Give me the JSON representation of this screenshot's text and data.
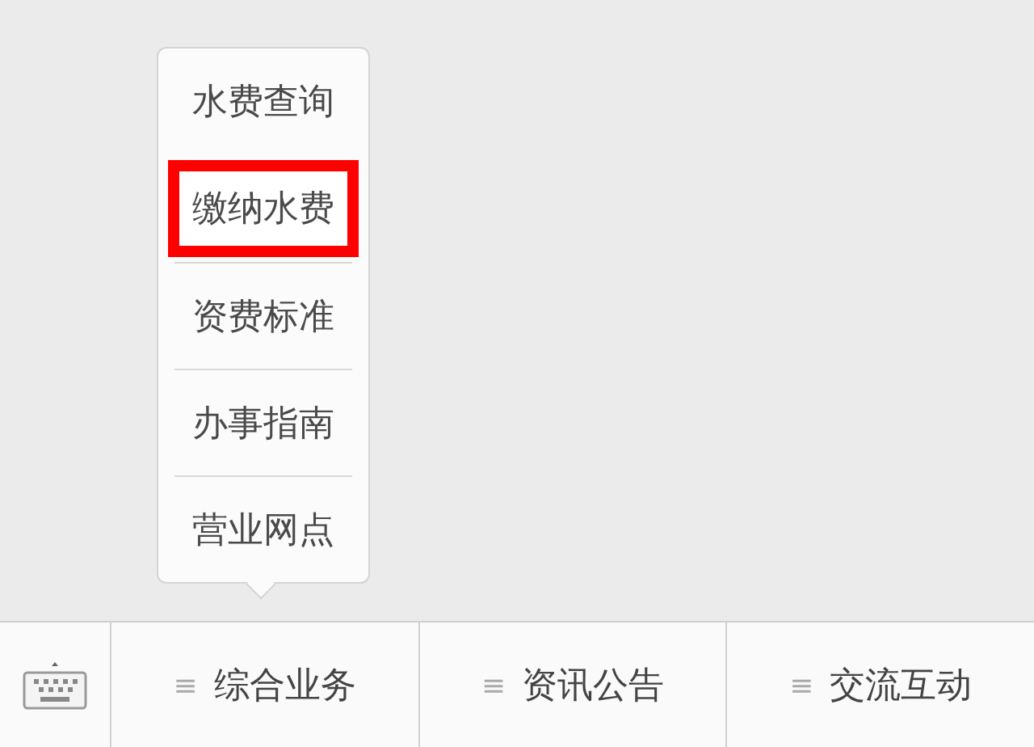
{
  "popup_menu": {
    "items": [
      {
        "label": "水费查询",
        "highlighted": false
      },
      {
        "label": "缴纳水费",
        "highlighted": true
      },
      {
        "label": "资费标准",
        "highlighted": false
      },
      {
        "label": "办事指南",
        "highlighted": false
      },
      {
        "label": "营业网点",
        "highlighted": false
      }
    ]
  },
  "bottom_menu": {
    "items": [
      {
        "icon": "≡",
        "label": "综合业务"
      },
      {
        "icon": "≡",
        "label": "资讯公告"
      },
      {
        "icon": "≡",
        "label": "交流互动"
      }
    ]
  }
}
